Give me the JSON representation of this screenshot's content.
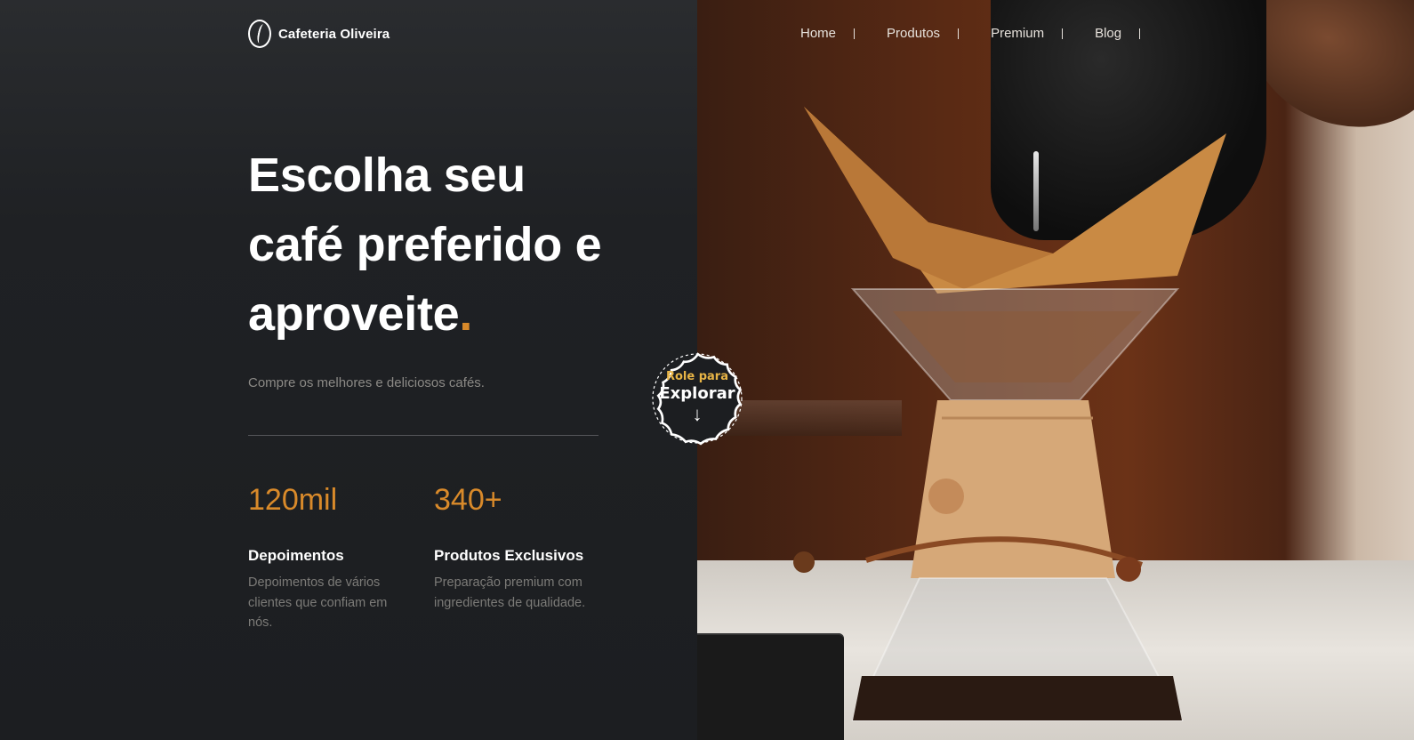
{
  "brand": {
    "name": "Cafeteria Oliveira"
  },
  "nav": [
    {
      "label": "Home"
    },
    {
      "label": "Produtos"
    },
    {
      "label": "Premium"
    },
    {
      "label": "Blog"
    }
  ],
  "hero": {
    "headline_line1": "Escolha seu",
    "headline_line2": "café preferido e",
    "headline_line3": "aproveite",
    "headline_dot": ".",
    "subtitle": "Compre os melhores e deliciosos cafés."
  },
  "stats": [
    {
      "value": "120mil",
      "title": "Depoimentos",
      "description": "Depoimentos de vários clientes que confiam em nós."
    },
    {
      "value": "340+",
      "title": "Produtos Exclusivos",
      "description": "Preparação premium com ingredientes de qualidade."
    }
  ],
  "badge": {
    "small": "Role para",
    "big": "Explorar",
    "arrow": "↓"
  },
  "colors": {
    "accent": "#d98a2a",
    "background": "#1c1e21",
    "badge_gold": "#e8b546"
  },
  "icons": {
    "logo": "coffee-bean-icon",
    "scroll": "arrow-down-icon"
  }
}
